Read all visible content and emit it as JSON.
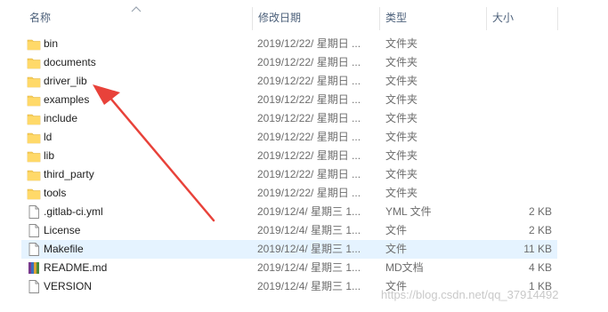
{
  "columns": {
    "name": "名称",
    "date": "修改日期",
    "type": "类型",
    "size": "大小"
  },
  "files": [
    {
      "name": "bin",
      "date": "2019/12/22/ 星期日 ...",
      "type": "文件夹",
      "size": "",
      "icon": "folder-icon"
    },
    {
      "name": "documents",
      "date": "2019/12/22/ 星期日 ...",
      "type": "文件夹",
      "size": "",
      "icon": "folder-icon"
    },
    {
      "name": "driver_lib",
      "date": "2019/12/22/ 星期日 ...",
      "type": "文件夹",
      "size": "",
      "icon": "folder-icon"
    },
    {
      "name": "examples",
      "date": "2019/12/22/ 星期日 ...",
      "type": "文件夹",
      "size": "",
      "icon": "folder-icon"
    },
    {
      "name": "include",
      "date": "2019/12/22/ 星期日 ...",
      "type": "文件夹",
      "size": "",
      "icon": "folder-icon"
    },
    {
      "name": "ld",
      "date": "2019/12/22/ 星期日 ...",
      "type": "文件夹",
      "size": "",
      "icon": "folder-icon"
    },
    {
      "name": "lib",
      "date": "2019/12/22/ 星期日 ...",
      "type": "文件夹",
      "size": "",
      "icon": "folder-icon"
    },
    {
      "name": "third_party",
      "date": "2019/12/22/ 星期日 ...",
      "type": "文件夹",
      "size": "",
      "icon": "folder-icon"
    },
    {
      "name": "tools",
      "date": "2019/12/22/ 星期日 ...",
      "type": "文件夹",
      "size": "",
      "icon": "folder-icon"
    },
    {
      "name": ".gitlab-ci.yml",
      "date": "2019/12/4/ 星期三 1...",
      "type": "YML 文件",
      "size": "2 KB",
      "icon": "file-icon"
    },
    {
      "name": "License",
      "date": "2019/12/4/ 星期三 1...",
      "type": "文件",
      "size": "2 KB",
      "icon": "file-icon"
    },
    {
      "name": "Makefile",
      "date": "2019/12/4/ 星期三 1...",
      "type": "文件",
      "size": "11 KB",
      "icon": "file-icon"
    },
    {
      "name": "README.md",
      "date": "2019/12/4/ 星期三 1...",
      "type": "MD文档",
      "size": "4 KB",
      "icon": "markdown-file-icon"
    },
    {
      "name": "VERSION",
      "date": "2019/12/4/ 星期三 1...",
      "type": "文件",
      "size": "1 KB",
      "icon": "file-icon"
    }
  ],
  "selected_file": "Makefile",
  "watermark": "https://blog.csdn.net/qq_37914492",
  "colors": {
    "folder": "#f7ce5b",
    "selection": "#e5f3ff",
    "arrow": "#e8423a",
    "header_text": "#4c607a"
  }
}
